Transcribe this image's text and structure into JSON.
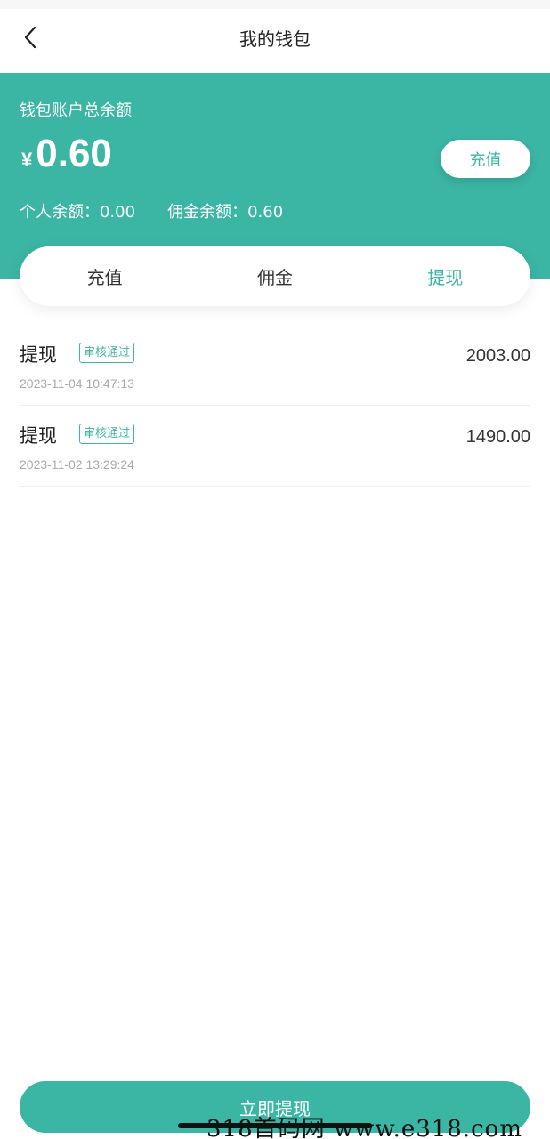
{
  "nav": {
    "title": "我的钱包"
  },
  "wallet": {
    "label": "钱包账户总余额",
    "currency": "¥",
    "total": "0.60",
    "recharge_label": "充值",
    "personal": "个人余额：0.00",
    "commission": "佣金余额：0.60"
  },
  "tabs": [
    {
      "label": "充值",
      "active": false
    },
    {
      "label": "佣金",
      "active": false
    },
    {
      "label": "提现",
      "active": true
    }
  ],
  "records": [
    {
      "title": "提现",
      "status": "审核通过",
      "time": "2023-11-04 10:47:13",
      "amount": "2003.00"
    },
    {
      "title": "提现",
      "status": "审核通过",
      "time": "2023-11-02 13:29:24",
      "amount": "1490.00"
    }
  ],
  "withdraw_button": "立即提现",
  "watermark": "318首码网 www.e318.com",
  "colors": {
    "accent": "#3bb5a4"
  }
}
